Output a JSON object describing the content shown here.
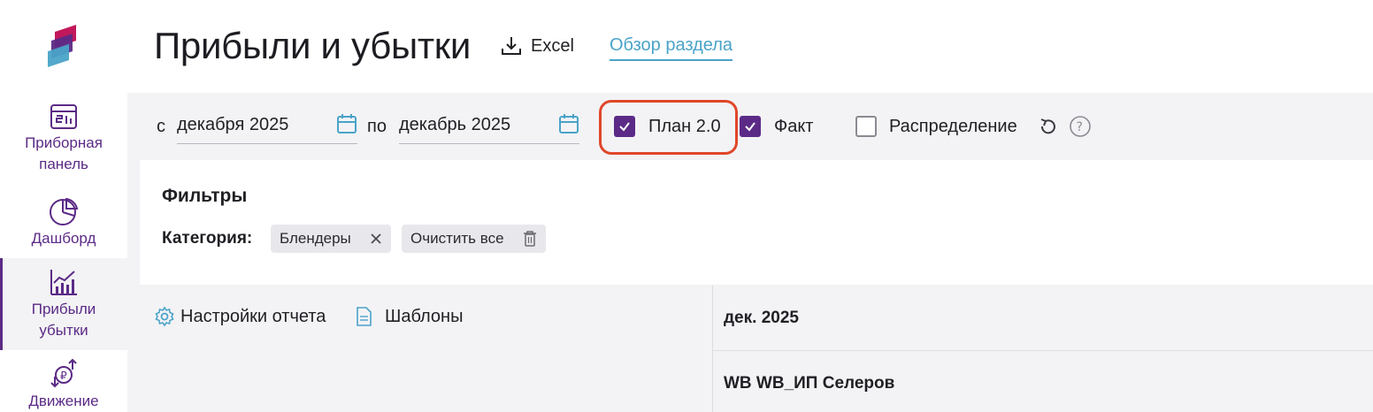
{
  "app": {
    "colors": {
      "accent": "#5b2a86",
      "link": "#4aa3c8",
      "highlight": "#e0472a",
      "logo_top": "#c2185b",
      "logo_mid": "#5b2a86",
      "logo_bottom": "#4aa3c8"
    }
  },
  "sidebar": {
    "items": [
      {
        "label_line1": "Приборная",
        "label_line2": "панель",
        "icon": "dashboard-panel-icon"
      },
      {
        "label_line1": "Дашборд",
        "icon": "pie-chart-icon"
      },
      {
        "label_line1": "Прибыли",
        "label_line2": "убытки",
        "icon": "profit-chart-icon",
        "active": true
      },
      {
        "label_line1": "Движение",
        "icon": "money-flow-icon"
      }
    ]
  },
  "header": {
    "title": "Прибыли и убытки",
    "excel_label": "Excel",
    "overview_link": "Обзор раздела"
  },
  "toolbar": {
    "from_label": "с",
    "from_value": "декабря 2025",
    "to_label": "по",
    "to_value": "декабрь 2025",
    "plan_label": "План 2.0",
    "plan_checked": true,
    "fact_label": "Факт",
    "fact_checked": true,
    "distribution_label": "Распределение",
    "distribution_checked": false
  },
  "filters": {
    "title": "Фильтры",
    "category_label": "Категория:",
    "chips": [
      "Блендеры"
    ],
    "clear_all": "Очистить все"
  },
  "report": {
    "settings_label": "Настройки отчета",
    "templates_label": "Шаблоны",
    "period_header": "дек. 2025",
    "account_header": "WB WB_ИП Селеров"
  }
}
